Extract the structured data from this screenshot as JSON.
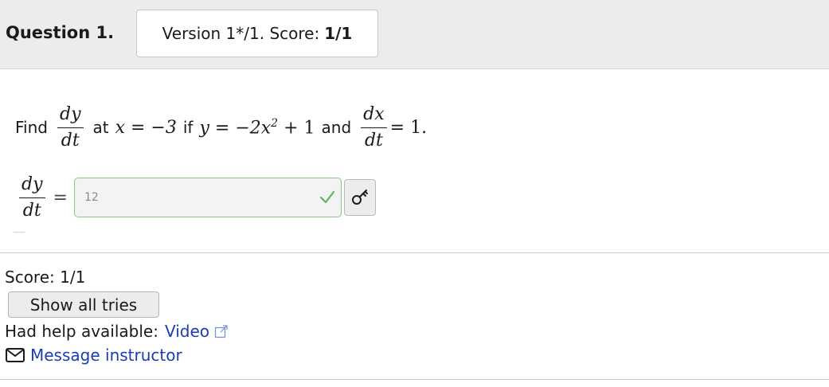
{
  "header": {
    "question_label": "Question 1.",
    "version_text": "Version 1*/1. Score:",
    "version_score": "1/1"
  },
  "problem": {
    "word_find": "Find",
    "word_at": "at",
    "word_if": "if",
    "word_and": "and",
    "frac1": {
      "num": "dy",
      "den": "dt"
    },
    "x_eq": "x = −3",
    "y_eq": "y = −2x",
    "y_exp": "2",
    "y_tail": "+ 1",
    "frac2": {
      "num": "dx",
      "den": "dt"
    },
    "rhs": "= 1."
  },
  "answer": {
    "frac": {
      "num": "dy",
      "den": "dt"
    },
    "equals": "=",
    "value": "12",
    "status": "correct",
    "status_color": "#5cb85c",
    "key_icon": "key-icon"
  },
  "footer": {
    "score_text": "Score: 1/1",
    "show_tries_label": "Show all tries",
    "help_text": "Had help available:",
    "video_link": "Video",
    "message_link": "Message instructor",
    "link_color": "#1a3cb4"
  }
}
